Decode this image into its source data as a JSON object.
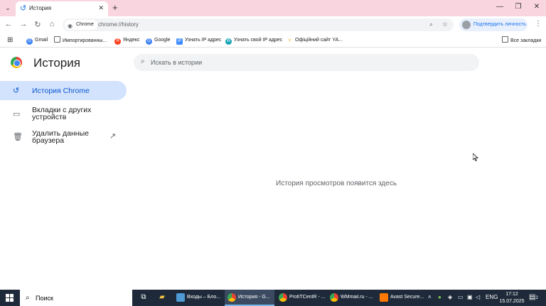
{
  "tab": {
    "title": "История"
  },
  "window": {
    "minimize": "—",
    "maximize": "❐",
    "close": "✕"
  },
  "toolbar": {
    "chip_label": "Chrome",
    "url": "chrome://history",
    "profile_label": "Подтвердить личность"
  },
  "bookmarks": {
    "items": [
      "Gmail",
      "Импортированны...",
      "Яндекс",
      "Google",
      "Узнать IP адрес",
      "Узнать свой IP адрес",
      "Офіційний сайт YA..."
    ],
    "all_label": "Все закладки"
  },
  "page": {
    "title": "История",
    "search_placeholder": "Искать в истории",
    "nav": {
      "history": "История Chrome",
      "tabs_other": "Вкладки с других устройств",
      "clear": "Удалить данные браузера"
    },
    "empty_message": "История просмотров появится здесь"
  },
  "taskbar": {
    "search_label": "Поиск",
    "apps": [
      "Входы – Бло...",
      "История - G...",
      "ProfiTCentR - ...",
      "WMmail.ru - ...",
      "Avast Secure..."
    ],
    "lang": "ENG",
    "time": "17:12",
    "date": "15.07.2025",
    "notifications": "2"
  },
  "colors": {
    "accent": "#0b57d0",
    "tabstrip": "#f9d5e0",
    "active_nav": "#d3e3fd",
    "taskbar": "#1e2a3a"
  }
}
